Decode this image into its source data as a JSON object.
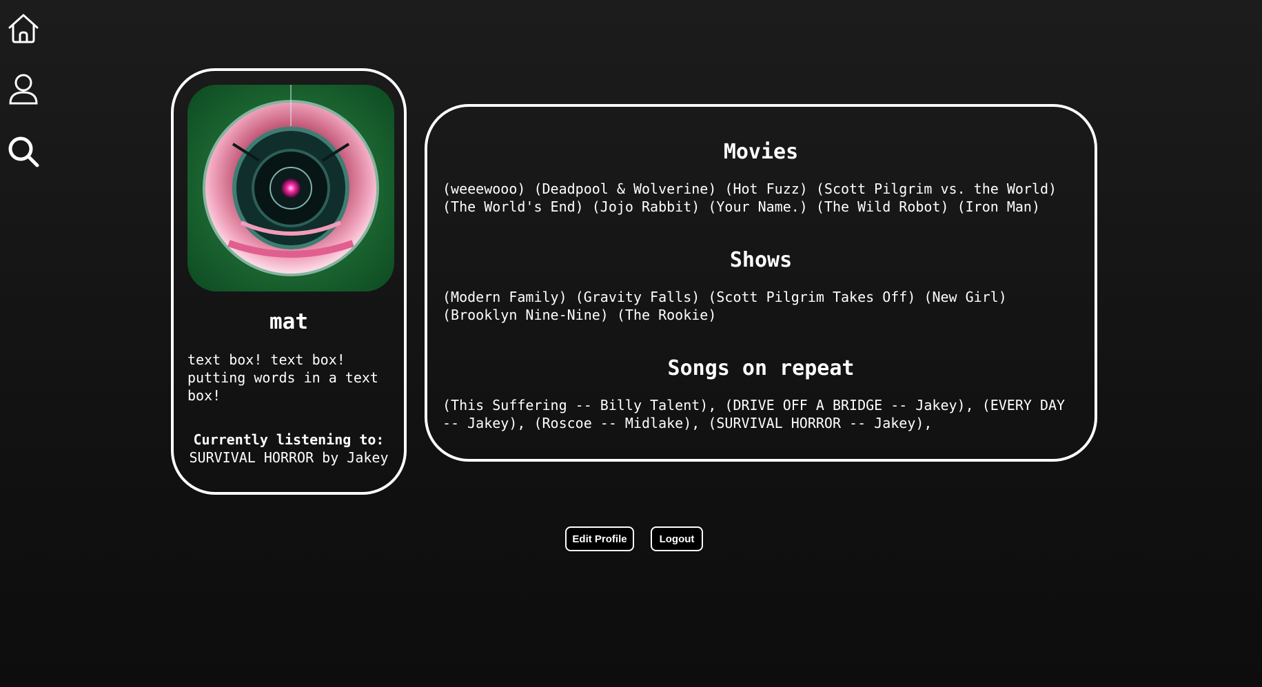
{
  "nav": {
    "items": [
      {
        "name": "home",
        "icon": "home-icon"
      },
      {
        "name": "profile",
        "icon": "user-icon"
      },
      {
        "name": "search",
        "icon": "search-icon"
      }
    ]
  },
  "profile": {
    "username": "mat",
    "bio": "text box! text box! putting words in a text box!",
    "listening_label": "Currently listening to:",
    "listening_value": "SURVIVAL HORROR by Jakey"
  },
  "sections": {
    "movies": {
      "title": "Movies",
      "items": [
        "(weeewooo)",
        "(Deadpool & Wolverine)",
        "(Hot Fuzz)",
        "(Scott Pilgrim vs. the World)",
        "(The World's End)",
        "(Jojo Rabbit)",
        "(Your Name.)",
        "(The Wild Robot)",
        "(Iron Man)"
      ]
    },
    "shows": {
      "title": "Shows",
      "items": [
        "(Modern Family)",
        "(Gravity Falls)",
        "(Scott Pilgrim Takes Off)",
        "(New Girl)",
        "(Brooklyn Nine-Nine)",
        "(The Rookie)"
      ]
    },
    "songs": {
      "title": "Songs on repeat",
      "items": [
        "(This Suffering -- Billy Talent),",
        "(DRIVE OFF A BRIDGE -- Jakey),",
        "(EVERY DAY -- Jakey),",
        "(Roscoe -- Midlake),",
        "(SURVIVAL HORROR -- Jakey),"
      ]
    }
  },
  "buttons": {
    "edit_profile": "Edit Profile",
    "logout": "Logout"
  },
  "colors": {
    "background": "#121212",
    "border": "#ffffff",
    "text": "#ffffff",
    "button_bg": "#000000"
  }
}
